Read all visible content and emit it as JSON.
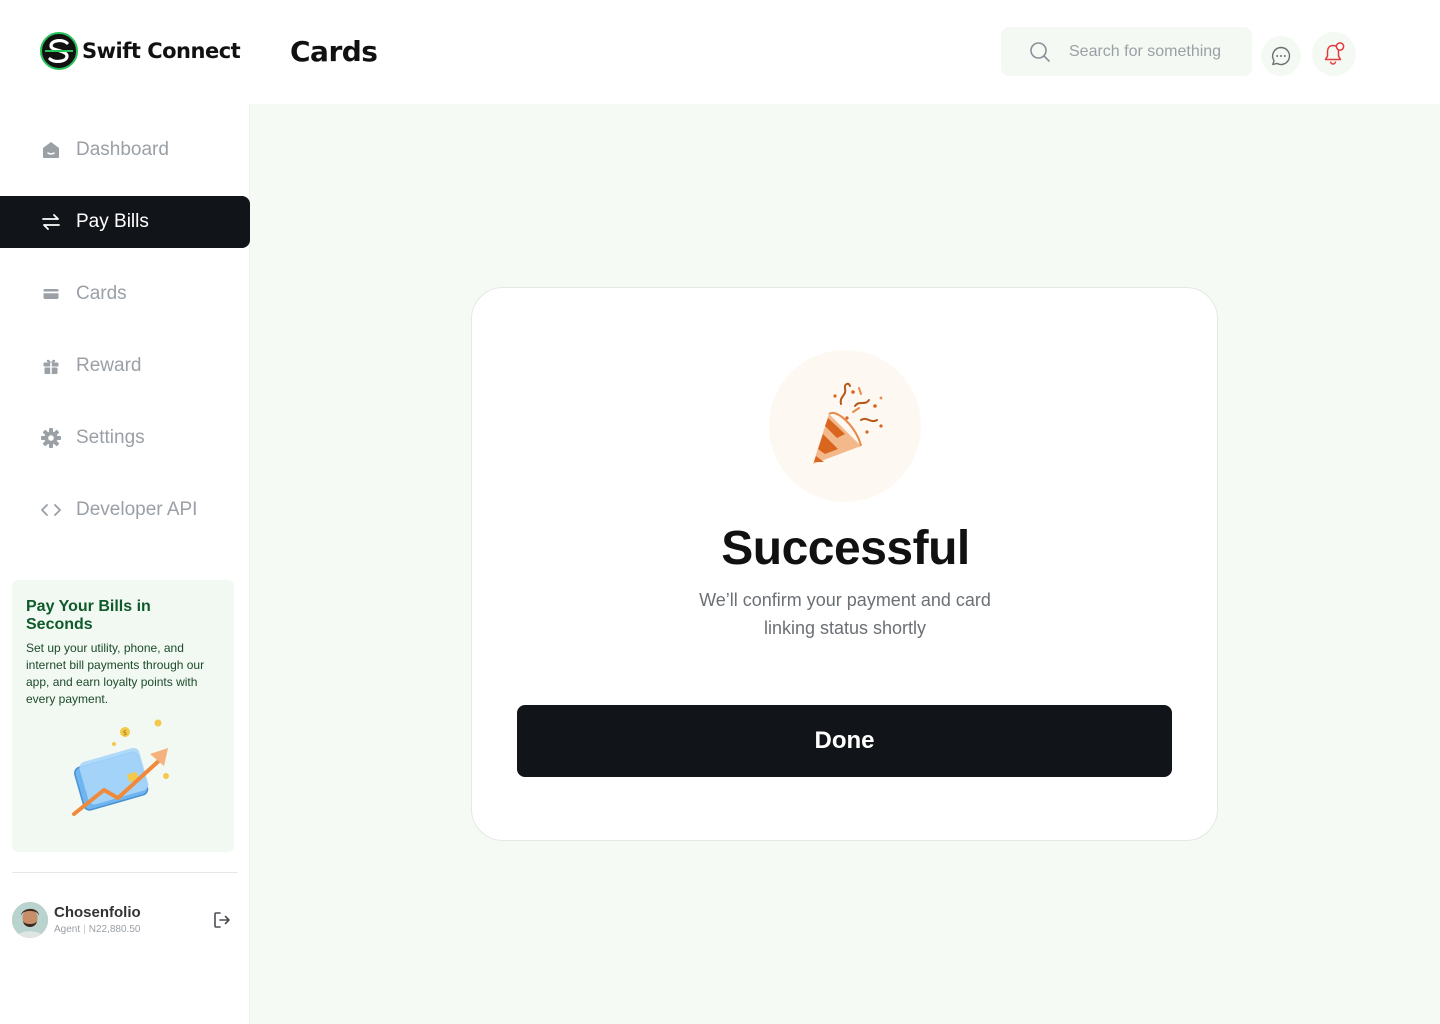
{
  "app": {
    "brand": "Swift Connect",
    "page_title": "Cards"
  },
  "header": {
    "search_placeholder": "Search for something",
    "icons": [
      "search-icon",
      "message-icon",
      "bell-icon"
    ]
  },
  "sidebar": {
    "items": [
      {
        "label": "Dashboard",
        "icon": "home-icon",
        "active": false
      },
      {
        "label": "Pay Bills",
        "icon": "transfer-icon",
        "active": true
      },
      {
        "label": "Cards",
        "icon": "card-icon",
        "active": false
      },
      {
        "label": "Reward",
        "icon": "gift-icon",
        "active": false
      },
      {
        "label": "Settings",
        "icon": "gear-icon",
        "active": false
      },
      {
        "label": "Developer API",
        "icon": "code-icon",
        "active": false
      }
    ],
    "promo": {
      "title": "Pay Your Bills in Seconds",
      "text": "Set up your utility, phone, and internet bill payments through our app, and earn loyalty points with every payment."
    },
    "user": {
      "name": "Chosenfolio",
      "role": "Agent",
      "balance": "N22,880.50"
    }
  },
  "modal": {
    "title": "Successful",
    "message": "We’ll confirm your payment and card linking status shortly",
    "button": "Done"
  },
  "colors": {
    "accent_dark": "#111418",
    "brand_green": "#0f5a2a",
    "main_bg": "#f5faf5",
    "alert_red": "#e23b3b"
  }
}
